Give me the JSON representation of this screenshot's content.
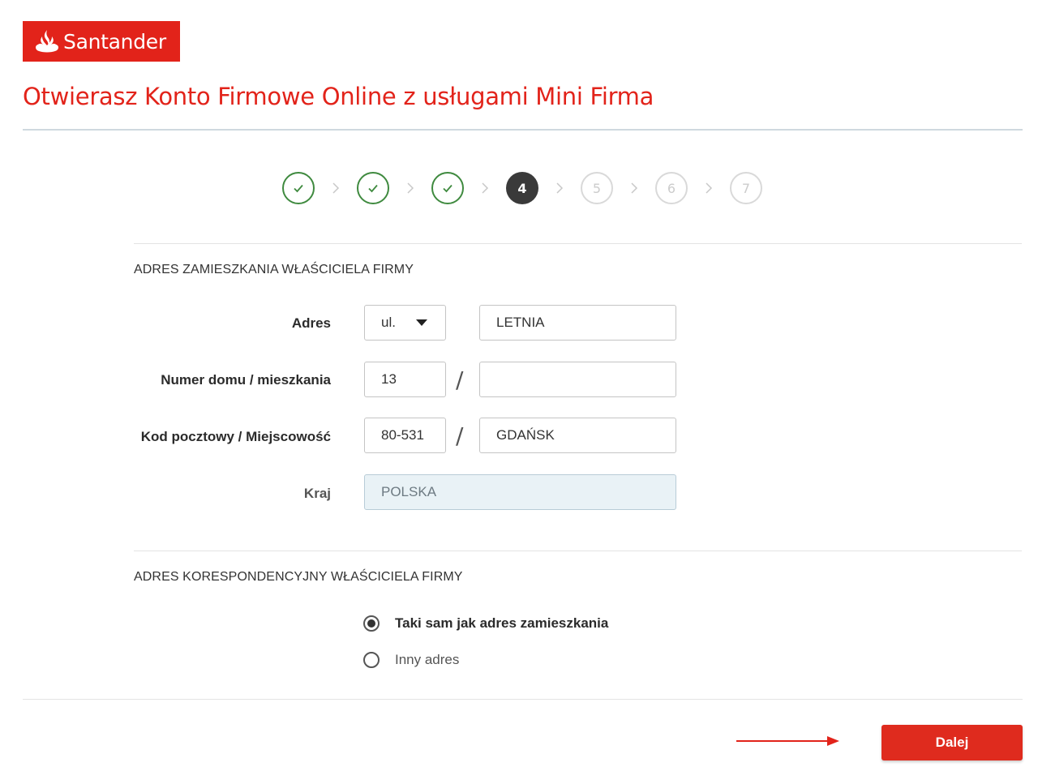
{
  "brand": {
    "name": "Santander",
    "color": "#e2231a"
  },
  "page": {
    "title": "Otwierasz Konto Firmowe Online z usługami Mini Firma"
  },
  "stepper": {
    "current": 4,
    "steps": [
      {
        "label": "1",
        "state": "done",
        "icon": "check-icon"
      },
      {
        "label": "2",
        "state": "done",
        "icon": "check-icon"
      },
      {
        "label": "3",
        "state": "done",
        "icon": "check-icon"
      },
      {
        "label": "4",
        "state": "active"
      },
      {
        "label": "5",
        "state": "todo"
      },
      {
        "label": "6",
        "state": "todo"
      },
      {
        "label": "7",
        "state": "todo"
      }
    ]
  },
  "residence": {
    "section_title": "ADRES ZAMIESZKANIA WŁAŚCICIELA FIRMY",
    "address_label": "Adres",
    "street_prefix": "ul.",
    "street": "LETNIA",
    "house_label": "Numer domu / mieszkania",
    "house_number": "13",
    "flat_number": "",
    "postal_label": "Kod pocztowy / Miejscowość",
    "postal_code": "80-531",
    "city": "GDAŃSK",
    "country_label": "Kraj",
    "country": "POLSKA",
    "separator": "/"
  },
  "correspondence": {
    "section_title": "ADRES KORESPONDENCYJNY WŁAŚCICIELA FIRMY",
    "options": [
      {
        "label": "Taki sam jak adres zamieszkania",
        "selected": true
      },
      {
        "label": "Inny adres",
        "selected": false
      }
    ]
  },
  "actions": {
    "next_label": "Dalej"
  },
  "colors": {
    "accent": "#e2231a",
    "done": "#3f8a3f",
    "active": "#3a3a3a"
  }
}
